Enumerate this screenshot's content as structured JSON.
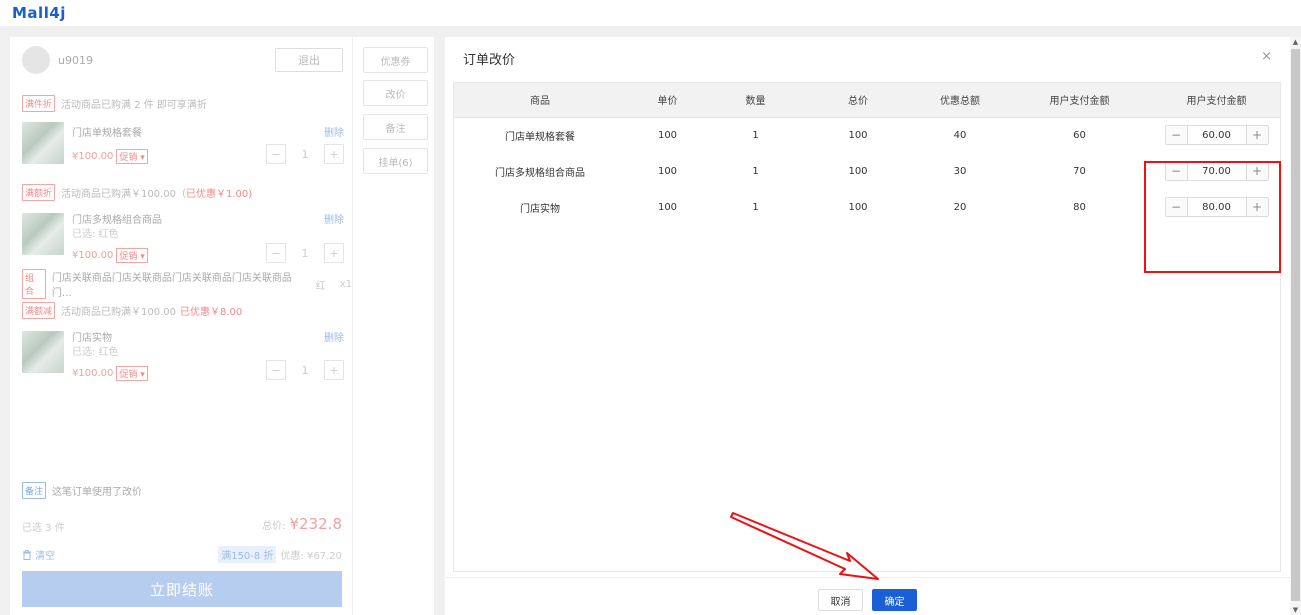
{
  "app": {
    "logo": "Mall4j"
  },
  "left": {
    "user": {
      "name": "u9019",
      "logout": "退出"
    },
    "groups": [
      {
        "tag": "满件折",
        "text": "活动商品已购满 2 件 即可享满折",
        "highlight": ""
      },
      {
        "tag": "满额折",
        "text": "活动商品已购满￥100.00（",
        "highlight": "已优惠￥1.00)"
      },
      {
        "tag": "满额减",
        "text": "活动商品已购满￥100.00",
        "highlight": "已优惠￥8.00"
      }
    ],
    "items": [
      {
        "name": "门店单规格套餐",
        "spec": "",
        "price": "¥100.00",
        "promo": "促销 ▾",
        "delete": "删除",
        "qty": "1"
      },
      {
        "name": "门店多规格组合商品",
        "spec": "已选: 红色",
        "price": "¥100.00",
        "promo": "促销 ▾",
        "delete": "删除",
        "qty": "1"
      },
      {
        "name": "门店实物",
        "spec": "已选: 红色",
        "price": "¥100.00",
        "promo": "促销 ▾",
        "delete": "删除",
        "qty": "1"
      }
    ],
    "combo": {
      "tag": "组合",
      "text": "门店关联商品门店关联商品门店关联商品门店关联商品门…",
      "spec": "红",
      "qty": "x1"
    },
    "remark": {
      "tag": "备注",
      "text": "这笔订单使用了改价"
    },
    "selected": "已选 3 件",
    "total_label": "总价:",
    "total_value": "¥232.8",
    "clear": "清空",
    "discount_tag": "满150-8 折",
    "discount_text": "优惠: ¥67.20",
    "checkout": "立即结账"
  },
  "mid": {
    "buttons": [
      "优惠券",
      "改价",
      "备注",
      "挂单(6)"
    ]
  },
  "modal": {
    "title": "订单改价",
    "close": "×",
    "columns": [
      "商品",
      "单价",
      "数量",
      "总价",
      "优惠总额",
      "用户支付金额",
      "用户支付金额"
    ],
    "rows": [
      {
        "name": "门店单规格套餐",
        "unit": "100",
        "qty": "1",
        "total": "100",
        "discount": "40",
        "pay": "60",
        "input": "60.00"
      },
      {
        "name": "门店多规格组合商品",
        "unit": "100",
        "qty": "1",
        "total": "100",
        "discount": "30",
        "pay": "70",
        "input": "70.00"
      },
      {
        "name": "门店实物",
        "unit": "100",
        "qty": "1",
        "total": "100",
        "discount": "20",
        "pay": "80",
        "input": "80.00"
      }
    ],
    "cancel": "取消",
    "confirm": "确定"
  },
  "colors": {
    "primary": "#1a5fd6",
    "annotation": "#e11111",
    "price": "#f08a8a"
  }
}
